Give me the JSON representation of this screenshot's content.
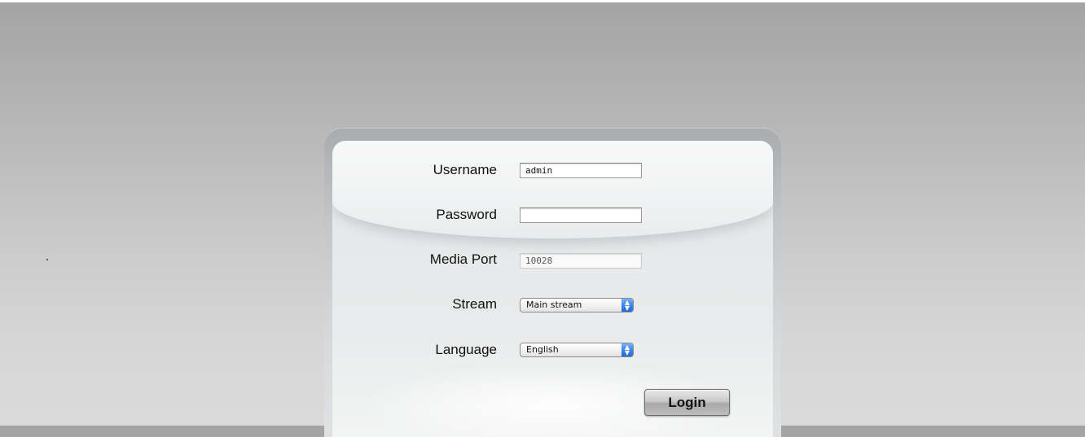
{
  "login_form": {
    "username": {
      "label": "Username",
      "value": "admin"
    },
    "password": {
      "label": "Password",
      "value": ""
    },
    "media_port": {
      "label": "Media Port",
      "value": "10028"
    },
    "stream": {
      "label": "Stream",
      "selected": "Main stream"
    },
    "language": {
      "label": "Language",
      "selected": "English"
    },
    "login_label": "Login"
  },
  "icons": {
    "select_arrows": "up-down-arrows-icon"
  }
}
